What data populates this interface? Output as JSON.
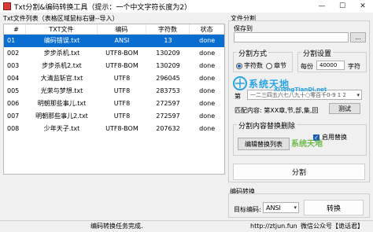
{
  "window": {
    "title": "Txt分割&编码转换工具（提示：一个中文字符长度为2）",
    "minimize": "—",
    "maximize": "☐",
    "close": "✕"
  },
  "file_list": {
    "group_label": "Txt文件列表（表格区域鼠标右键--导入）",
    "columns": [
      "#",
      "TXT文件",
      "编码",
      "字符数",
      "状态"
    ],
    "rows": [
      {
        "idx": "01",
        "name": "编码错误.txt",
        "encoding": "ANSI",
        "chars": "13",
        "status": "done",
        "selected": true
      },
      {
        "idx": "002",
        "name": "步步杀机.txt",
        "encoding": "UTF8-BOM",
        "chars": "130209",
        "status": "done",
        "selected": false
      },
      {
        "idx": "003",
        "name": "步步杀机2.txt",
        "encoding": "UTF8-BOM",
        "chars": "130209",
        "status": "done",
        "selected": false
      },
      {
        "idx": "004",
        "name": "大清监斩官.txt",
        "encoding": "UTF8",
        "chars": "296045",
        "status": "done",
        "selected": false
      },
      {
        "idx": "005",
        "name": "光荣与梦想.txt",
        "encoding": "UTF8",
        "chars": "283753",
        "status": "done",
        "selected": false
      },
      {
        "idx": "006",
        "name": "明朝那些事儿.txt",
        "encoding": "UTF8",
        "chars": "272597",
        "status": "done",
        "selected": false
      },
      {
        "idx": "007",
        "name": "明朝那些事儿2.txt",
        "encoding": "UTF8",
        "chars": "272597",
        "status": "done",
        "selected": false
      },
      {
        "idx": "008",
        "name": "少年天子.txt",
        "encoding": "UTF8-BOM",
        "chars": "207632",
        "status": "done",
        "selected": false
      }
    ]
  },
  "split": {
    "group_label": "文件分割",
    "save_to_label": "保存到",
    "save_to_value": "",
    "browse_label": "...",
    "mode_label": "分割方式",
    "mode_char": "字符数",
    "mode_chapter": "章节",
    "mode_selected": "char",
    "settings_label": "分割设置",
    "per_label": "每份",
    "per_value": "40000",
    "unit_label": "字符",
    "chapter_marker_label": "第",
    "chapter_marker_value": "一二三四五六七八九十○零百千0-9 1 2",
    "match_label": "匹配内容: 第XX章,节,部,集,回",
    "test_label": "测试",
    "replace_group_label": "分割内容替换删除",
    "edit_replace_label": "编辑替换列表",
    "enable_replace_label": "启用替换",
    "enable_replace_checked": true,
    "split_button": "分割"
  },
  "convert": {
    "group_label": "编码转换",
    "target_label": "目标编码:",
    "target_value": "ANSI",
    "convert_button": "转换"
  },
  "status": {
    "message": "编码转换任务完成.",
    "site": "http://ztjun.fun",
    "wechat": "微信公众号【诡话君】"
  },
  "watermark": {
    "text": "系统天地",
    "sub": "XiTongTianDi.net",
    "green": "系统天地"
  }
}
